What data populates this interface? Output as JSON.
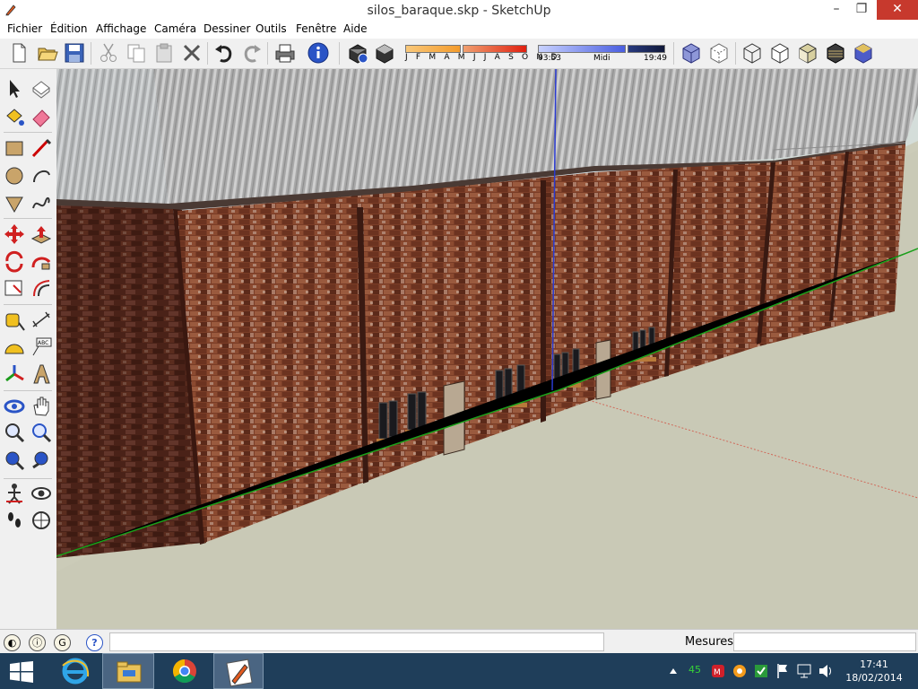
{
  "window": {
    "title": "silos_baraque.skp - SketchUp",
    "controls": {
      "minimize": "–",
      "maximize": "❐",
      "close": "✕"
    }
  },
  "menu": [
    "Fichier",
    "Édition",
    "Affichage",
    "Caméra",
    "Dessiner",
    "Outils",
    "Fenêtre",
    "Aide"
  ],
  "toolbar": {
    "buttons": [
      "new-icon",
      "open-icon",
      "save-icon",
      "cut-icon",
      "copy-icon",
      "paste-icon",
      "erase-icon",
      "undo-icon",
      "redo-icon",
      "print-icon",
      "model-info-icon",
      "shadow-settings-icon",
      "shadow-toggle-icon"
    ],
    "shadows": {
      "months": "J F M A M J J A S O N D",
      "time_start": "03:53",
      "time_mid": "Midi",
      "time_end": "19:49"
    },
    "styles": [
      "xray-icon",
      "back-edges-icon",
      "wireframe-icon",
      "hidden-line-icon",
      "shaded-icon",
      "shaded-textures-icon",
      "monochrome-icon"
    ]
  },
  "tools": [
    "select-icon",
    "make-component-icon",
    "paint-bucket-icon",
    "eraser-icon",
    "rectangle-icon",
    "line-icon",
    "circle-icon",
    "arc-icon",
    "polygon-icon",
    "freehand-icon",
    "move-icon",
    "push-pull-icon",
    "rotate-icon",
    "follow-me-icon",
    "scale-icon",
    "offset-icon",
    "tape-measure-icon",
    "dimension-icon",
    "protractor-icon",
    "text-icon",
    "axes-icon",
    "3d-text-icon",
    "orbit-icon",
    "pan-icon",
    "zoom-icon",
    "zoom-window-icon",
    "zoom-extents-icon",
    "previous-view-icon",
    "position-camera-icon",
    "look-around-icon",
    "walk-icon",
    "section-plane-icon"
  ],
  "statusbar": {
    "measurements_label": "Mesures",
    "measurements_value": "",
    "hint_text": ""
  },
  "taskbar": {
    "apps": [
      "ie-icon",
      "file-explorer-icon",
      "chrome-icon",
      "sketchup-icon"
    ],
    "tray_count": "45",
    "time": "17:41",
    "date": "18/02/2014"
  }
}
